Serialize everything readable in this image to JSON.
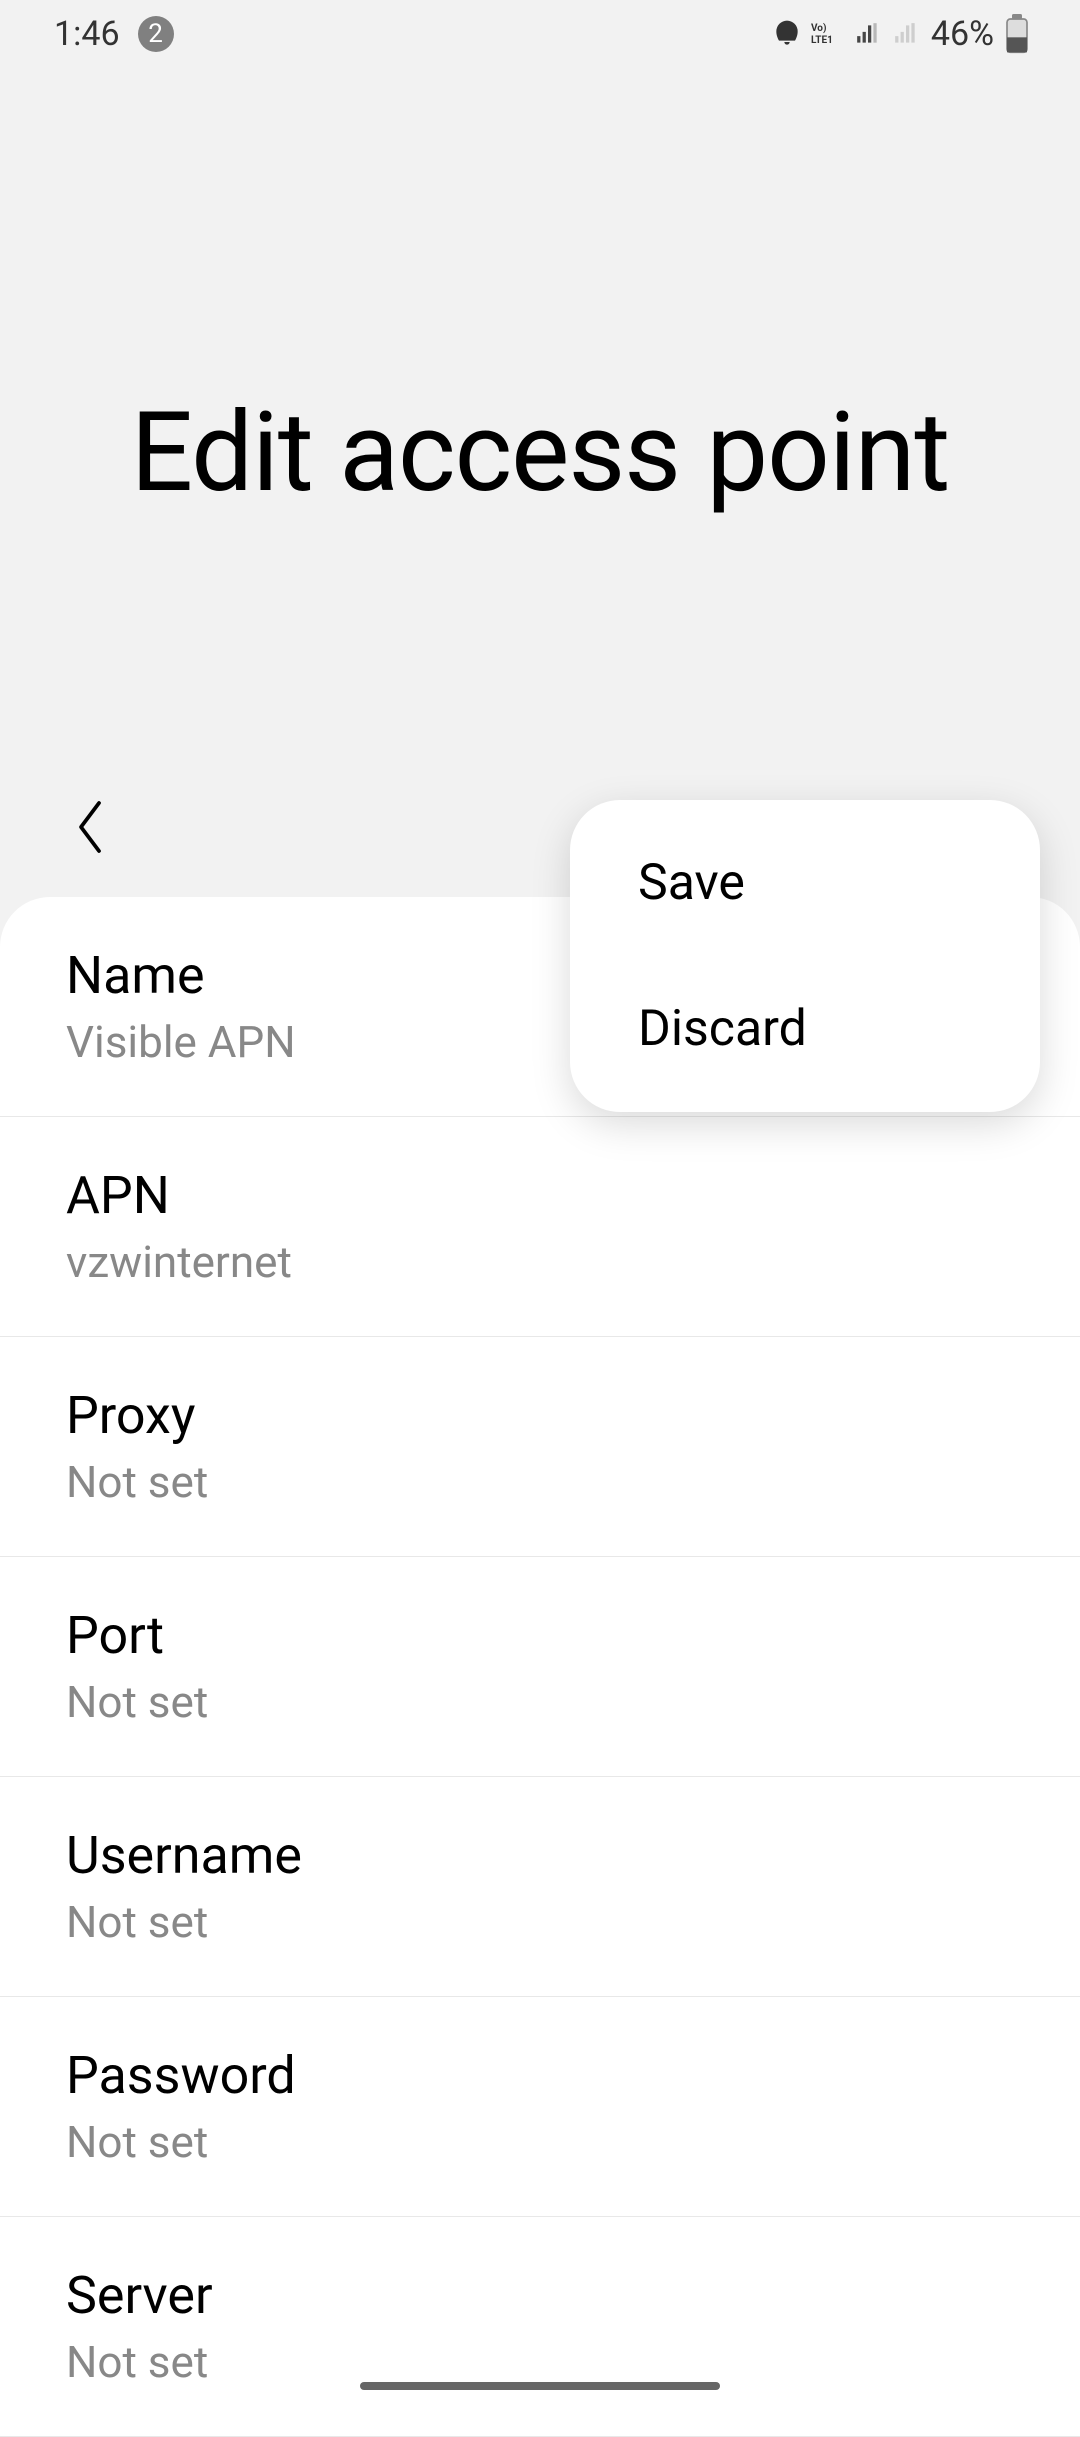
{
  "status": {
    "time": "1:46",
    "notif_count": "2",
    "battery": "46%"
  },
  "header": {
    "title": "Edit access point"
  },
  "menu": {
    "save": "Save",
    "discard": "Discard"
  },
  "settings": [
    {
      "label": "Name",
      "value": "Visible APN"
    },
    {
      "label": "APN",
      "value": "vzwinternet"
    },
    {
      "label": "Proxy",
      "value": "Not set"
    },
    {
      "label": "Port",
      "value": "Not set"
    },
    {
      "label": "Username",
      "value": "Not set"
    },
    {
      "label": "Password",
      "value": "Not set"
    },
    {
      "label": "Server",
      "value": "Not set"
    }
  ]
}
